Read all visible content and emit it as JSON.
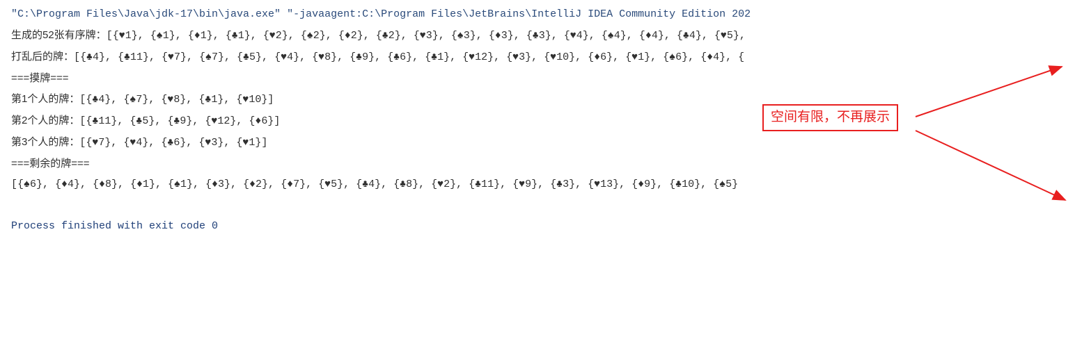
{
  "command": "\"C:\\Program Files\\Java\\jdk-17\\bin\\java.exe\" \"-javaagent:C:\\Program Files\\JetBrains\\IntelliJ IDEA Community Edition 202",
  "lines": {
    "ordered_prefix": "生成的52张有序牌：",
    "ordered_cards": "[{♥1}, {♠1}, {♦1}, {♣1}, {♥2}, {♠2}, {♦2}, {♣2}, {♥3}, {♠3}, {♦3}, {♣3}, {♥4}, {♠4}, {♦4}, {♣4}, {♥5},",
    "shuffled_prefix": "打乱后的牌：",
    "shuffled_cards": "[{♣4}, {♣11}, {♥7}, {♠7}, {♣5}, {♥4}, {♥8}, {♣9}, {♣6}, {♣1}, {♥12}, {♥3}, {♥10}, {♦6}, {♥1}, {♠6}, {♦4}, {",
    "deal_header": "===摸牌===",
    "p1_prefix": "第1个人的牌：",
    "p1_cards": "[{♣4}, {♠7}, {♥8}, {♣1}, {♥10}]",
    "p2_prefix": "第2个人的牌：",
    "p2_cards": "[{♣11}, {♣5}, {♣9}, {♥12}, {♦6}]",
    "p3_prefix": "第3个人的牌：",
    "p3_cards": "[{♥7}, {♥4}, {♣6}, {♥3}, {♥1}]",
    "remain_header": "===剩余的牌===",
    "remain_cards": "[{♠6}, {♦4}, {♦8}, {♦1}, {♠1}, {♦3}, {♦2}, {♦7}, {♥5}, {♣4}, {♣8}, {♥2}, {♣11}, {♥9}, {♣3}, {♥13}, {♦9}, {♣10}, {♠5}"
  },
  "exit_message": "Process finished with exit code 0",
  "annotation": "空间有限，不再展示"
}
